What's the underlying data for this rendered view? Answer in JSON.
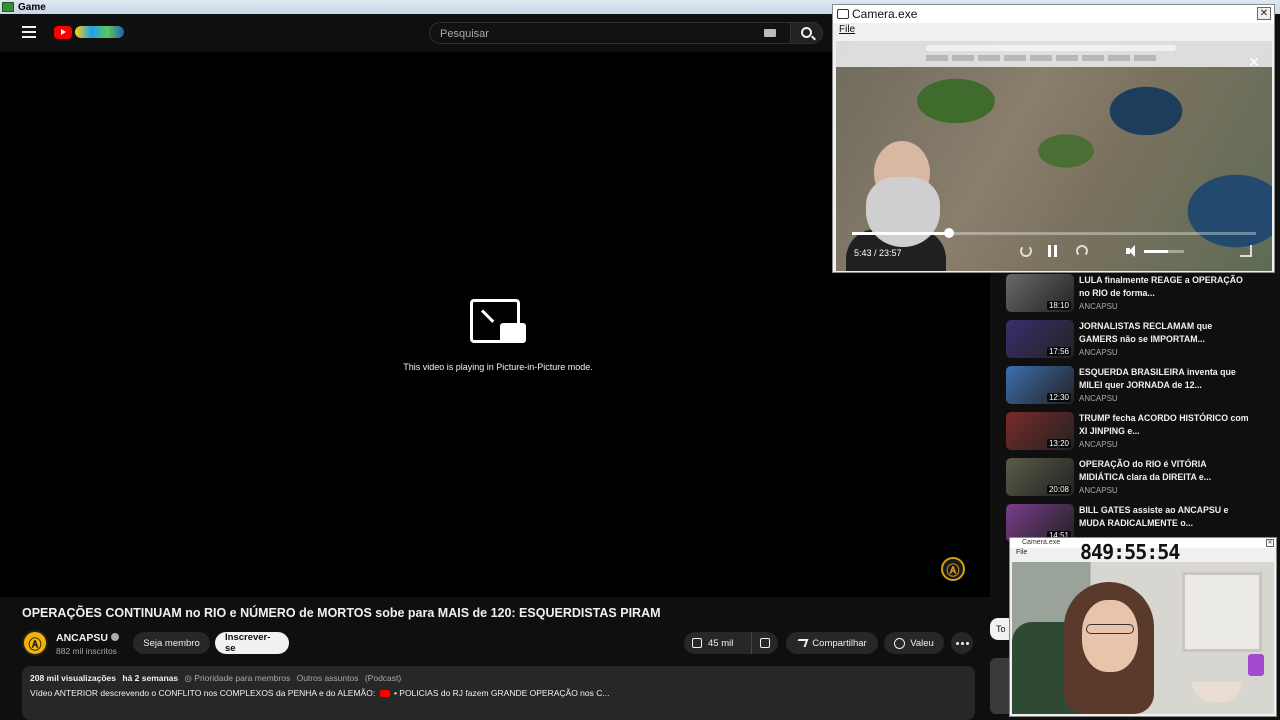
{
  "os": {
    "app_name": "Game"
  },
  "header": {
    "search_placeholder": "Pesquisar"
  },
  "player": {
    "pip_message": "This video is playing in Picture-in-Picture mode.",
    "watermark_icon": "anarchy-a-icon"
  },
  "video": {
    "title": "OPERAÇÕES CONTINUAM no RIO e NÚMERO de MORTOS sobe para MAIS de 120: ESQUERDISTAS PIRAM",
    "channel_name": "ANCAPSU",
    "avatar_letter": "Ⓐ",
    "subscribers": "882 mil inscritos",
    "join_label": "Seja membro",
    "subscribe_label": "Inscrever-se",
    "likes": "45 mil",
    "share_label": "Compartilhar",
    "thanks_label": "Valeu",
    "views": "208 mil visualizações",
    "age": "há 2 semanas",
    "tag_members": "◎ Prioridade para membros",
    "tag_other": "Outros assuntos",
    "tag_podcast": "(Podcast)",
    "description_prefix": "Vídeo ANTERIOR descrevendo o CONFLITO nos COMPLEXOS da PENHA e do ALEMÃO:",
    "description_link": "• POLICIAS do RJ fazem GRANDE OPERAÇÃO nos C..."
  },
  "side_chip_label": "To",
  "recommendations": [
    {
      "title": "LULA finalmente REAGE a OPERAÇÃO no RIO de forma...",
      "channel": "ANCAPSU",
      "duration": "18:10",
      "thumb_color": "#6a6a6a"
    },
    {
      "title": "JORNALISTAS RECLAMAM que GAMERS não se IMPORTAM...",
      "channel": "ANCAPSU",
      "duration": "17:56",
      "thumb_color": "#3b2f6e"
    },
    {
      "title": "ESQUERDA BRASILEIRA inventa que MILEI quer JORNADA de 12...",
      "channel": "ANCAPSU",
      "duration": "12:30",
      "thumb_color": "#3d6fb0"
    },
    {
      "title": "TRUMP fecha ACORDO HISTÓRICO com XI JINPING e...",
      "channel": "ANCAPSU",
      "duration": "13:20",
      "thumb_color": "#7a2a2a"
    },
    {
      "title": "OPERAÇÃO do RIO é VITÓRIA MIDIÁTICA clara da DIREITA e...",
      "channel": "ANCAPSU",
      "duration": "20:08",
      "thumb_color": "#5b5b4a"
    },
    {
      "title": "BILL GATES assiste ao ANCAPSU e MUDA RADICALMENTE o...",
      "channel": "",
      "duration": "14:51",
      "thumb_color": "#7a3c8a"
    }
  ],
  "camera_window": {
    "title": "Camera.exe",
    "menu_file": "File",
    "close_glyph": "✕",
    "time": "5:43 / 23:57",
    "progress_fraction": 0.24,
    "volume_fraction": 0.6
  },
  "camera_window_2": {
    "title": "Camera.exe",
    "menu_file": "File",
    "clock": "849:55:54"
  }
}
